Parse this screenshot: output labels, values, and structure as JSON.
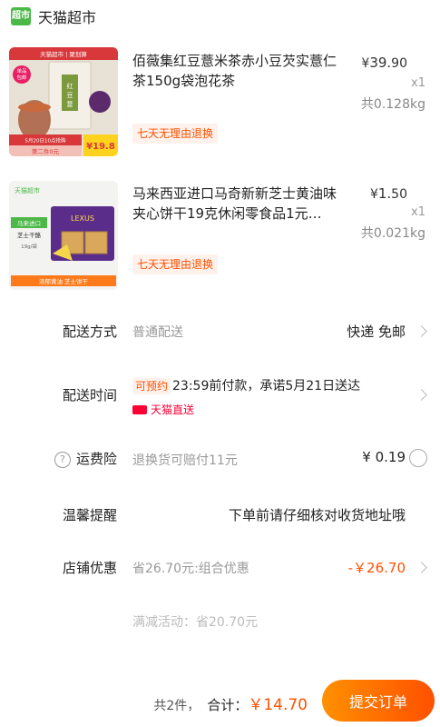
{
  "store": {
    "logo_text": "超市",
    "name": "天猫超市"
  },
  "products": [
    {
      "title": "佰薇集红豆薏米茶赤小豆芡实薏仁茶150g袋泡花茶",
      "price_symbol": "¥",
      "price_int": "39.",
      "price_dec": "90",
      "qty": "x1",
      "weight": "共0.128kg",
      "badge": "七天无理由退换",
      "thumb": {
        "banner": "天猫超市 | 聚划算",
        "tag1": "单品包邮",
        "promo": "5月20日10点抢购",
        "second": "第二件0元",
        "price": "¥19.8"
      }
    },
    {
      "title": "马来西亚进口马奇新新芝士黄油味夹心饼干19克休闲零食品1元…",
      "price_symbol": "¥",
      "price_int": "1.",
      "price_dec": "50",
      "qty": "x1",
      "weight": "共0.021kg",
      "badge": "七天无理由退换",
      "thumb": {
        "brand": "天猫超市",
        "tag": "马来进口",
        "name": "芝士干酪",
        "weight": "19g/袋",
        "lexus": "LEXUS",
        "footer": "浓郁黄油 芝士饼干"
      }
    }
  ],
  "delivery": {
    "label": "配送方式",
    "value": "普通配送",
    "right": "快递 免邮"
  },
  "delivery_time": {
    "label": "配送时间",
    "tag": "可预约",
    "text": "23:59前付款，承诺5月21日送达",
    "service": "天猫直送"
  },
  "insurance": {
    "icon": "?",
    "label": "运费险",
    "value": "退换货可赔付11元",
    "price": "¥ 0.19"
  },
  "reminder": {
    "label": "温馨提醒",
    "text": "下单前请仔细核对收货地址哦"
  },
  "shop_discount": {
    "label": "店铺优惠",
    "value": "省26.70元:组合优惠",
    "amount": "-￥26.70"
  },
  "promotion": {
    "text": "满减活动：省20.70元"
  },
  "footer": {
    "count": "共2件，",
    "total_label": "合计：",
    "total": "￥14.70",
    "submit": "提交订单"
  },
  "colors": {
    "accent": "#ff5000",
    "tmall_red": "#ff0036",
    "supermarket_green": "#4cb848"
  }
}
